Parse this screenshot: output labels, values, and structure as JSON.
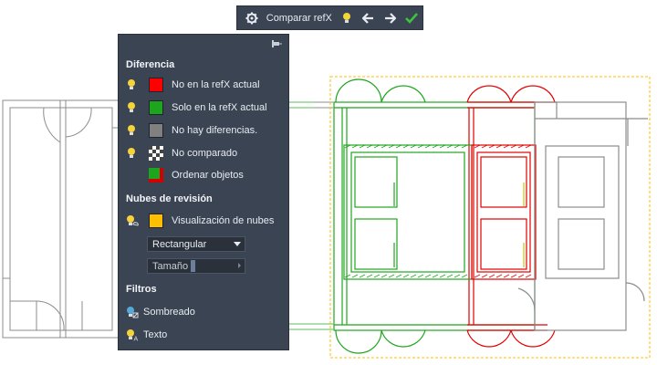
{
  "toolbar": {
    "title": "Comparar refX",
    "icons": [
      "gear-icon",
      "lightbulb-icon",
      "arrow-left-icon",
      "arrow-right-icon",
      "checkmark-icon"
    ],
    "check_color": "#3cc43c"
  },
  "panel": {
    "sections": {
      "difference": "Diferencia",
      "clouds": "Nubes de revisión",
      "filters": "Filtros"
    },
    "difference_items": [
      {
        "label": "No en la refX actual",
        "color": "#ff0000"
      },
      {
        "label": "Solo en la refX actual",
        "color": "#1ea51e"
      },
      {
        "label": "No hay diferencias.",
        "color": "#808080"
      },
      {
        "label": "No comparado",
        "color": "checkered"
      },
      {
        "label": "Ordenar objetos",
        "color": "#1ea51e/#d40000"
      }
    ],
    "cloud_display": {
      "label": "Visualización de nubes",
      "color": "#ffbf00"
    },
    "shape_select": {
      "value": "Rectangular"
    },
    "size_select": {
      "value": "Tamaño"
    },
    "filters": [
      {
        "label": "Sombreado",
        "icon": "hatch-filter-icon"
      },
      {
        "label": "Texto",
        "icon": "text-filter-icon"
      }
    ]
  },
  "colors": {
    "panel_bg": "#3b4453",
    "added": "#1ea51e",
    "removed": "#e00000",
    "unchanged": "#808080",
    "cloud": "#ffbf00"
  }
}
